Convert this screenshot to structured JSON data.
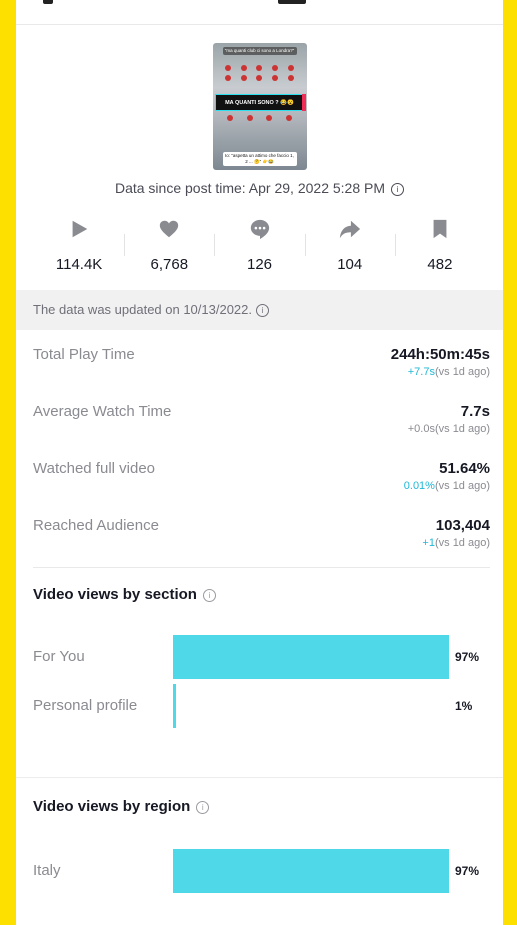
{
  "post": {
    "thumbnail": {
      "caption_top": "\"ma quanti club ci sono a Londra?\"",
      "highlight": "MA QUANTI SONO ? 😂😮",
      "caption_bottom": "Io: \"aspetta un attimo che faccio 1, 2 ... 🤔\" 👉😂"
    },
    "since_label": "Data since post time: Apr 29, 2022 5:28 PM",
    "info_glyph": "i"
  },
  "stats": [
    {
      "icon": "play-icon",
      "value": "114.4K"
    },
    {
      "icon": "heart-icon",
      "value": "6,768"
    },
    {
      "icon": "comment-icon",
      "value": "126"
    },
    {
      "icon": "share-icon",
      "value": "104"
    },
    {
      "icon": "bookmark-icon",
      "value": "482"
    }
  ],
  "updated_notice": "The data was updated on 10/13/2022.",
  "metrics": [
    {
      "label": "Total Play Time",
      "value": "244h:50m:45s",
      "delta": "+7.7s",
      "delta_suffix": "(vs 1d ago)",
      "delta_highlight": true
    },
    {
      "label": "Average Watch Time",
      "value": "7.7s",
      "delta": "+0.0s",
      "delta_suffix": "(vs 1d ago)",
      "delta_highlight": false
    },
    {
      "label": "Watched full video",
      "value": "51.64%",
      "delta": "0.01%",
      "delta_suffix": "(vs 1d ago)",
      "delta_highlight": true
    },
    {
      "label": "Reached Audience",
      "value": "103,404",
      "delta": "+1",
      "delta_suffix": "(vs 1d ago)",
      "delta_highlight": true
    }
  ],
  "sections": {
    "by_section": {
      "title": "Video views by section",
      "rows": [
        {
          "label": "For You",
          "percent": 97,
          "percent_label": "97%"
        },
        {
          "label": "Personal profile",
          "percent": 1,
          "percent_label": "1%"
        }
      ]
    },
    "by_region": {
      "title": "Video views by region",
      "rows": [
        {
          "label": "Italy",
          "percent": 97,
          "percent_label": "97%"
        }
      ]
    }
  },
  "colors": {
    "frame": "#FEE000",
    "bar": "#4FD8E8",
    "delta_positive": "#20B8D6"
  }
}
